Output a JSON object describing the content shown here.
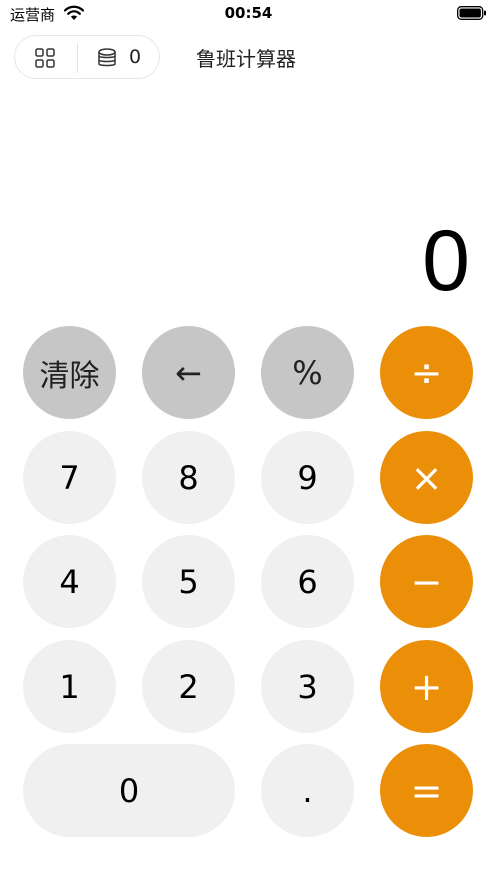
{
  "status_bar": {
    "carrier": "运营商",
    "time": "00:54",
    "icons": [
      "wifi-icon",
      "battery-icon"
    ]
  },
  "nav": {
    "coin_count": "0",
    "title": "鲁班计算器",
    "icons": [
      "grid-icon",
      "stack-icon"
    ]
  },
  "display": {
    "value": "0"
  },
  "keys": {
    "clear": "清除",
    "backspace": "←",
    "percent": "%",
    "divide": "÷",
    "seven": "7",
    "eight": "8",
    "nine": "9",
    "multiply": "×",
    "four": "4",
    "five": "5",
    "six": "6",
    "minus": "−",
    "one": "1",
    "two": "2",
    "three": "3",
    "plus": "+",
    "zero": "0",
    "dot": ".",
    "equals": "="
  },
  "colors": {
    "operator": "#eb8f08",
    "function": "#c6c6c6",
    "number": "#f0f0f0"
  }
}
